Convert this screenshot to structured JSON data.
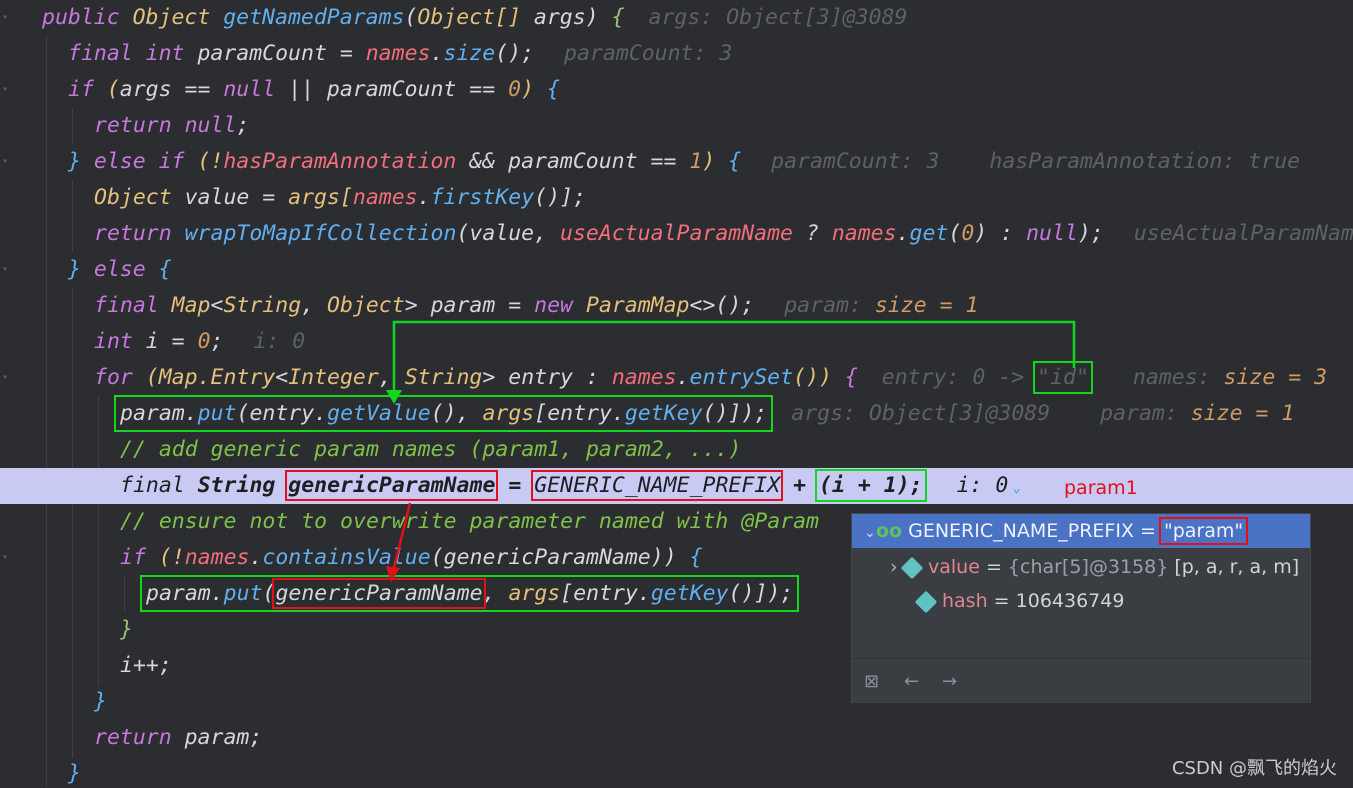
{
  "code": {
    "l1": {
      "kw1": "public ",
      "ty1": "Object ",
      "fn1": "getNamedParams",
      "p1": "(",
      "ty2": "Object[] ",
      "a1": "args",
      "p2": ") ",
      "br": "{",
      "hint": "args: Object[3]@3089"
    },
    "l2": {
      "kw1": "final ",
      "kw2": "int ",
      "v1": "paramCount = ",
      "f1": "names",
      "p1": ".",
      "fn1": "size",
      "p2": "();",
      "hint": "paramCount: 3"
    },
    "l3": {
      "kw1": "if ",
      "p1": "(",
      "a1": "args",
      "p2": " == ",
      "kw2": "null",
      "p3": " || paramCount == ",
      "n1": "0",
      "p4": ") ",
      "br": "{"
    },
    "l4": {
      "kw1": "return ",
      "kw2": "null",
      ";": ";"
    },
    "l5": {
      "br1": "} ",
      "kw1": "else if ",
      "p1": "(!",
      "f1": "hasParamAnnotation",
      "p2": " && paramCount == ",
      "n1": "1",
      "p3": ") ",
      "br2": "{",
      "hint1": "paramCount: 3",
      "hint2": "hasParamAnnotation: true"
    },
    "l6": {
      "ty1": "Object ",
      "v1": "value = ",
      "a1": "args",
      "p1": "[",
      "f1": "names",
      "p2": ".",
      "fn1": "firstKey",
      "p3": "()];"
    },
    "l7": {
      "kw1": "return ",
      "fn1": "wrapToMapIfCollection",
      "p1": "(value, ",
      "f1": "useActualParamName",
      "p2": " ? ",
      "f2": "names",
      "p3": ".",
      "fn2": "get",
      "p4": "(",
      "n1": "0",
      "p5": ") : ",
      "kw2": "null",
      "p6": ");",
      "hint": "useActualParamName"
    },
    "l8": {
      "br1": "} ",
      "kw1": "else ",
      "br2": "{"
    },
    "l9": {
      "kw1": "final ",
      "ty1": "Map",
      "p1": "<",
      "ty2": "String",
      "p2": ", ",
      "ty3": "Object",
      "p3": "> param = ",
      "kw2": "new ",
      "ty4": "ParamMap",
      "p4": "<>();",
      "hint": "param:",
      "hintsz": "size = 1"
    },
    "l10": {
      "kw1": "int ",
      "v1": "i = ",
      "n1": "0",
      ";": ";",
      "hint": "i: 0"
    },
    "l11": {
      "kw1": "for ",
      "p1": "(",
      "ty1": "Map.Entry",
      "p2": "<",
      "ty2": "Integer",
      "p3": ", ",
      "ty3": "String",
      "p4": "> entry : ",
      "f1": "names",
      "p5": ".",
      "fn1": "entrySet",
      "p6": "()) ",
      "br": "{",
      "hint1": "entry: 0 -> ",
      "hintstr": "\"id\"",
      "hint2": "names:",
      "hintsz": "size = 3"
    },
    "l12": {
      "v1": "param.",
      "fn1": "put",
      "p1": "(entry.",
      "fn2": "getValue",
      "p2": "(), ",
      "a1": "args",
      "p3": "[entry.",
      "fn3": "getKey",
      "p4": "()]);",
      "hint1": "args: Object[3]@3089",
      "hint2": "param:",
      "hintsz": "size = 1"
    },
    "l13": {
      "cm": "// add generic param names (param1, param2, ...)"
    },
    "l14": {
      "kw1": "final ",
      "ty1": "String ",
      "v1": "genericParamName",
      "p1": " = ",
      "f1": "GENERIC_NAME_PREFIX",
      "p2": " + ",
      "v2": "(i + 1);",
      "hint": "i: 0"
    },
    "l15": {
      "cm": "// ensure not to overwrite parameter named with @Param"
    },
    "l16": {
      "kw1": "if ",
      "p1": "(!",
      "f1": "names",
      "p2": ".",
      "fn1": "containsValue",
      "p3": "(genericParamName)) ",
      "br": "{"
    },
    "l17": {
      "v1": "param.",
      "fn1": "put",
      "p1": "(",
      "v2": "genericParamName",
      "p2": ", ",
      "a1": "args",
      "p3": "[entry.",
      "fn2": "getKey",
      "p4": "()]);"
    },
    "l18": {
      "br": "}"
    },
    "l19": {
      "v1": "i++;"
    },
    "l20": {
      "br": "}"
    },
    "l21": {
      "kw1": "return ",
      "v1": "param;"
    },
    "l22": {
      "br": "}"
    }
  },
  "annotation": {
    "note": "param1"
  },
  "popup": {
    "row1": {
      "name": "GENERIC_NAME_PREFIX",
      "eq": " = ",
      "val": "\"param\""
    },
    "row2": {
      "name": "value",
      "eq": " = ",
      "gray": "{char[5]@3158}",
      "val": " [p, a, r, a, m]"
    },
    "row3": {
      "name": "hash",
      "eq": " = ",
      "val": "106436749"
    },
    "toolbar": {
      "icons": [
        "folder-close-icon",
        "arrow-left-icon",
        "arrow-right-icon"
      ]
    }
  },
  "watermark": "CSDN @飘飞的焰火",
  "colors": {
    "highlight": "#c8caf4",
    "green_box": "#12d71e",
    "red_box": "#e3101a",
    "popup_selected": "#4a72c5"
  }
}
